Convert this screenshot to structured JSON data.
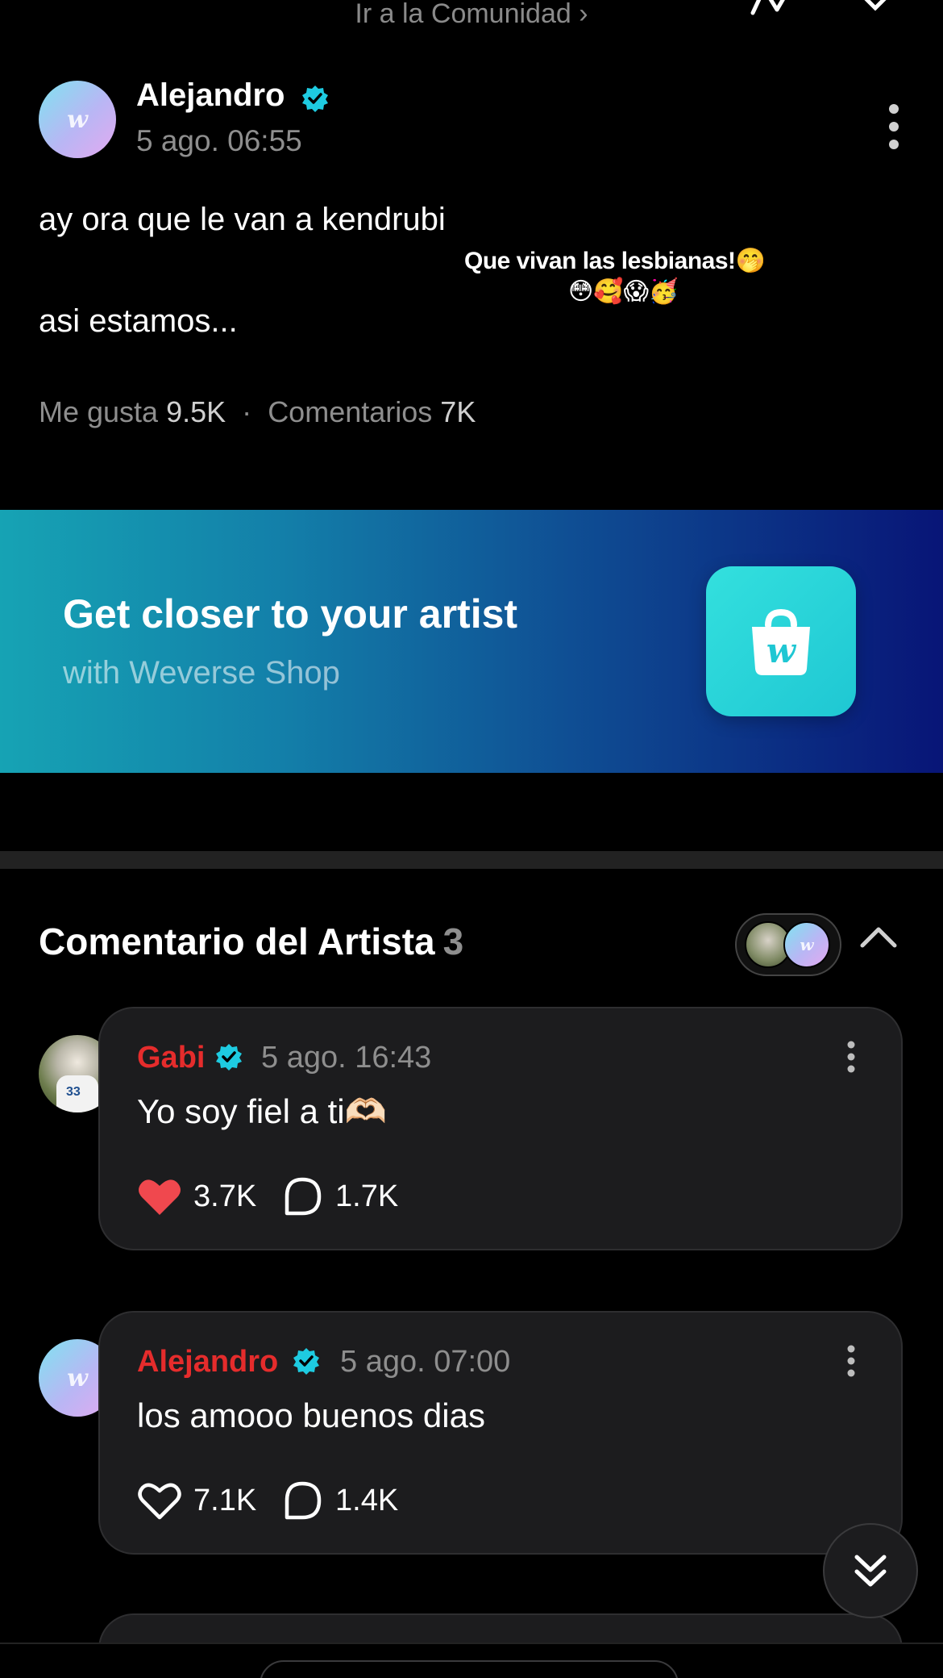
{
  "topbar": {
    "community_link": "Ir a la Comunidad ›"
  },
  "post": {
    "author": "Alejandro",
    "avatar_letter": "w",
    "time": "5 ago. 06:55",
    "line1": "ay ora que le van a kendrubi",
    "line2": "asi estamos...",
    "sticker_text": "Que vivan las lesbianas!🤭",
    "sticker_emojis": "😳🥰😱🥳",
    "likes_label": "Me gusta",
    "likes": "9.5K",
    "comments_label": "Comentarios",
    "comments": "7K"
  },
  "banner": {
    "title": "Get closer to your artist",
    "subtitle": "with Weverse Shop",
    "icon_letter": "w"
  },
  "artist_comments": {
    "title": "Comentario del Artista",
    "count": "3",
    "avatar_letter": "w",
    "items": [
      {
        "author": "Gabi",
        "time": "5 ago. 16:43",
        "text": "Yo soy fiel a ti🫶🏻",
        "likes": "3.7K",
        "replies": "1.7K",
        "liked": true,
        "jersey": "33"
      },
      {
        "author": "Alejandro",
        "time": "5 ago. 07:00",
        "text": "los amooo buenos dias",
        "likes": "7.1K",
        "replies": "1.4K",
        "liked": false,
        "avatar_letter": "w"
      }
    ]
  },
  "colors": {
    "verified": "#1ecbe1",
    "artist_name": "#e52c2c",
    "liked_heart": "#f0484e"
  }
}
